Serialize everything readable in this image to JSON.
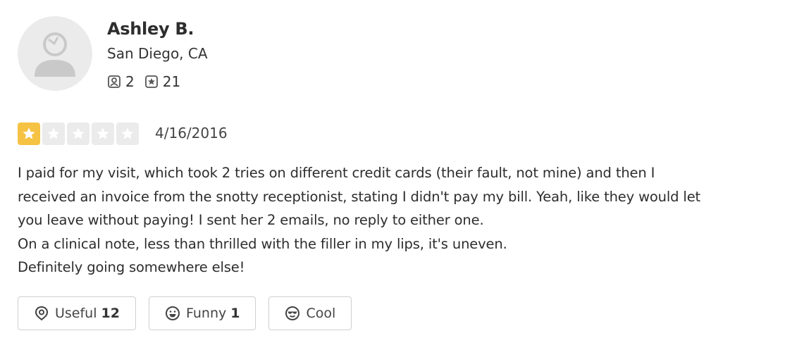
{
  "reviewer": {
    "name": "Ashley B.",
    "location": "San Diego, CA",
    "friends_count": "2",
    "reviews_count": "21",
    "avatar_icon": "default-user-avatar"
  },
  "review": {
    "rating": 1,
    "max_rating": 5,
    "date": "4/16/2016",
    "text_lines": [
      "I paid for my visit, which took 2 tries on different credit cards  (their fault, not mine) and then I",
      "received an invoice from the snotty receptionist, stating I didn't pay my bill. Yeah, like they would let",
      "you leave without paying! I sent her 2 emails, no reply to either one.",
      "On a clinical note, less than thrilled with the filler in my lips, it's uneven.",
      "Definitely going somewhere else!"
    ]
  },
  "reactions": {
    "useful": {
      "label": "Useful",
      "count": "12",
      "icon": "useful-icon"
    },
    "funny": {
      "label": "Funny",
      "count": "1",
      "icon": "funny-icon"
    },
    "cool": {
      "label": "Cool",
      "icon": "cool-icon"
    }
  },
  "colors": {
    "star_active": "#f6c244",
    "star_inactive": "#ebebeb"
  }
}
